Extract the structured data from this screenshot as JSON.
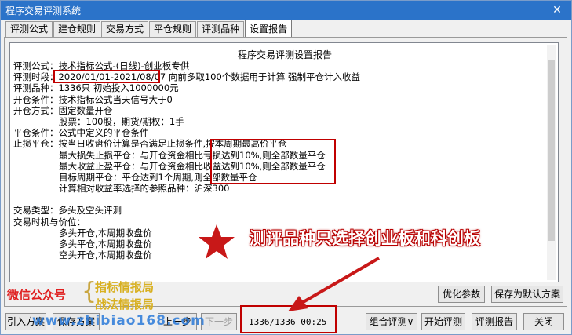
{
  "window": {
    "title": "程序交易评测系统",
    "close_glyph": "✕"
  },
  "tabs": [
    "评测公式",
    "建仓规则",
    "交易方式",
    "平仓规则",
    "评测品种",
    "设置报告"
  ],
  "active_tab": 5,
  "report": {
    "heading": "程序交易评测设置报告",
    "lines": [
      "评测公式：技术指标公式-(日线)-创业板专供",
      "评测时段：2020/01/01-2021/08/07 向前多取100个数据用于计算 强制平仓计入收益",
      "评测品种：1336只 初始投入1000000元",
      "开仓条件：技术指标公式当天信号大于0",
      "开仓方式：固定数量开仓",
      "股票：100股，期货/期权：1手",
      "平仓条件：公式中定义的平仓条件",
      "止损平仓：按当日收盘价计算是否满足止损条件,按本周期最高价平仓",
      "最大损失止损平仓：与开仓资金相比亏损达到10%,则全部数量平仓",
      "最大收益止盈平仓：与开仓资金相比收益达到10%,则全部数量平仓",
      "目标周期平仓：平仓达到1个周期,则全部数量平仓",
      "计算相对收益率选择的参照品种：沪深300",
      "",
      "交易类型：多头及空头评测",
      "交易时机与价位：",
      "多头开仓,本周期收盘价",
      "多头平仓,本周期收盘价",
      "空头开仓,本周期收盘价"
    ]
  },
  "annotation": {
    "text": "测评品种只选择创业板和科创板"
  },
  "watermark": {
    "wechat_label": "微信公众号",
    "brace": "{",
    "line1": "指标情报局",
    "line2": "战法情报局",
    "site": "www.zhibiao168.com"
  },
  "buttons": {
    "optimize": "优化参数",
    "save_default": "保存为默认方案",
    "load_plan": "引入方案",
    "save_plan": "保存方案",
    "prev": "上一步",
    "next": "下一步",
    "combo": "组合评测∨",
    "start": "开始评测",
    "report": "评测报告",
    "close": "关闭"
  },
  "progress": "1336/1336 00:25",
  "colors": {
    "accent": "#2b73c9",
    "highlight": "#c00000"
  }
}
